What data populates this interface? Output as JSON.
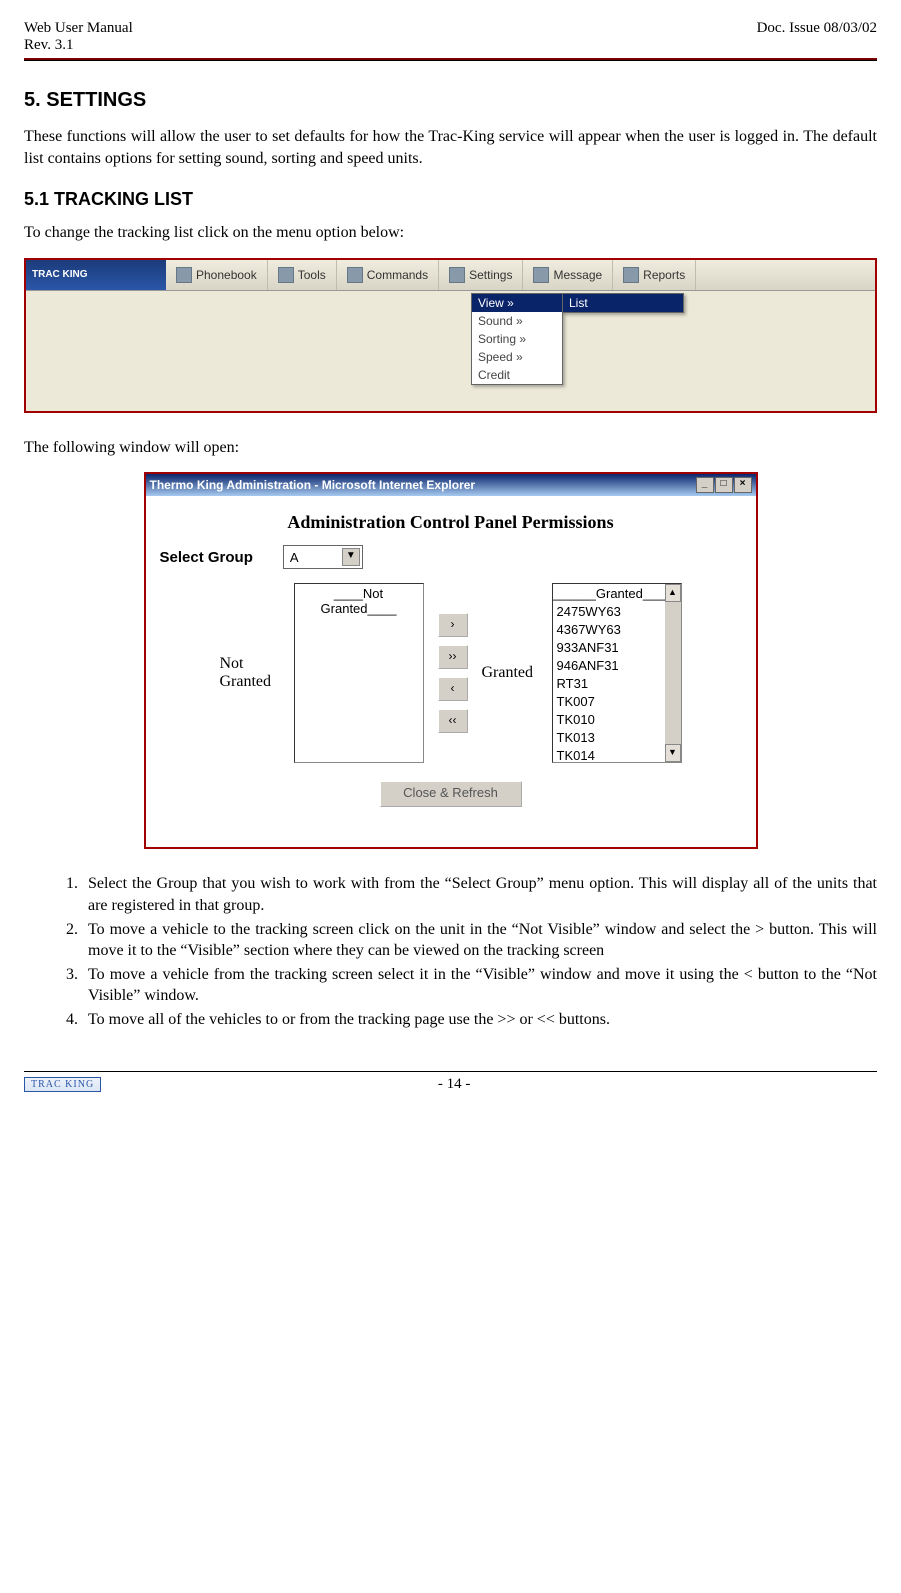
{
  "header": {
    "left1": "Web User Manual",
    "left2": "Rev. 3.1",
    "right": "Doc. Issue 08/03/02"
  },
  "h1": "5. SETTINGS",
  "p1": "These functions will allow the user to set defaults for how the Trac-King service will appear when the user is logged in.  The default list contains options for setting sound, sorting and speed units.",
  "h2": "5.1 TRACKING LIST",
  "p2": "To change the tracking list click on the menu option below:",
  "toolbar": {
    "logo": "TRAC KING",
    "items": [
      "Phonebook",
      "Tools",
      "Commands",
      "Settings",
      "Message",
      "Reports"
    ]
  },
  "menu": {
    "items": [
      "View  »",
      "Sound  »",
      "Sorting  »",
      "Speed  »",
      "Credit"
    ],
    "sub": "List"
  },
  "p3": "The following window will open:",
  "win": {
    "title": "Thermo King Administration - Microsoft Internet Explorer",
    "perm_title": "Administration Control Panel Permissions",
    "select_label": "Select Group",
    "select_value": "A",
    "left_label": "Not\nGranted",
    "right_label": "Granted",
    "not_granted_header": "____Not Granted____",
    "granted_header": "______Granted______",
    "granted_items": [
      "2475WY63",
      "4367WY63",
      "933ANF31",
      "946ANF31",
      "RT31",
      "TK007",
      "TK010",
      "TK013",
      "TK014"
    ],
    "move": {
      "r": "›",
      "rr": "››",
      "l": "‹",
      "ll": "‹‹"
    },
    "close": "Close & Refresh"
  },
  "steps": [
    "Select the Group that you wish to work with from the “Select Group” menu option.  This will display all of the units that are registered in that group.",
    "To move a vehicle to the tracking screen click on the unit in the “Not Visible” window and select the > button.   This will move it to the “Visible” section where they can be viewed on the tracking screen",
    "To move a vehicle from the tracking screen select it in the “Visible” window and move it using the < button to the “Not Visible” window.",
    "To move all of the vehicles to or from the tracking page use the >> or << buttons."
  ],
  "footer": {
    "logo": "TRAC KING",
    "page": "- 14 -"
  }
}
